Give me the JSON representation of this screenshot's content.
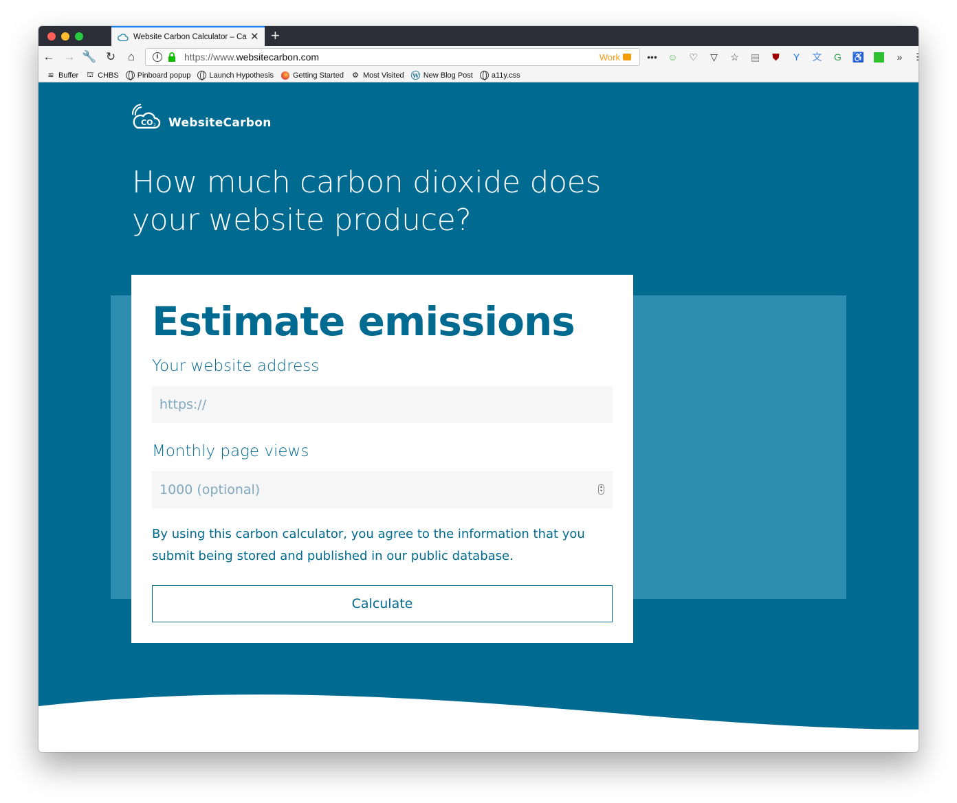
{
  "browser": {
    "tab_title": "Website Carbon Calculator – Ca",
    "url_prefix": "https://www.",
    "url_domain": "websitecarbon.com",
    "container_label": "Work",
    "bookmarks": [
      {
        "label": "Buffer",
        "icon": "stack-icon"
      },
      {
        "label": "CHBS",
        "icon": "bag-icon"
      },
      {
        "label": "Pinboard popup",
        "icon": "globe-icon"
      },
      {
        "label": "Launch Hypothesis",
        "icon": "globe-icon"
      },
      {
        "label": "Getting Started",
        "icon": "firefox-icon"
      },
      {
        "label": "Most Visited",
        "icon": "gear-icon"
      },
      {
        "label": "New Blog Post",
        "icon": "wordpress-icon"
      },
      {
        "label": "a11y.css",
        "icon": "globe-icon"
      }
    ]
  },
  "site": {
    "brand": "WebsiteCarbon",
    "headline_line1": "How much carbon dioxide does",
    "headline_line2": "your website produce?"
  },
  "form": {
    "heading": "Estimate emissions",
    "address_label": "Your website address",
    "address_placeholder": "https://",
    "views_label": "Monthly page views",
    "views_placeholder": "1000 (optional)",
    "notice_line1": "By using this carbon calculator, you agree to the information that you",
    "notice_line2": "submit being stored and published in our public database.",
    "submit_label": "Calculate"
  },
  "colors": {
    "page_bg": "#006a91",
    "panel_bg": "#308db2",
    "accent": "#006a91",
    "container_work": "#f29c0b"
  }
}
